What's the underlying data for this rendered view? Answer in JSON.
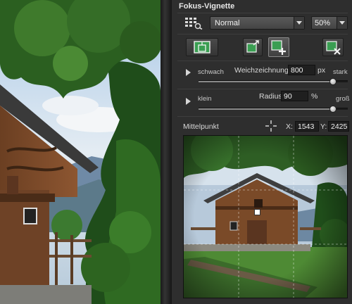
{
  "panel": {
    "title": "Fokus-Vignette",
    "blend_mode": "Normal",
    "opacity": "50%"
  },
  "weichzeichnung": {
    "min_label": "schwach",
    "name": "Weichzeichnung",
    "value": "800",
    "unit": "px",
    "max_label": "stark",
    "slider_fraction": 0.9
  },
  "radius": {
    "min_label": "klein",
    "name": "Radius",
    "value": "90",
    "unit": "%",
    "max_label": "groß",
    "slider_fraction": 0.9
  },
  "mittelpunkt": {
    "label": "Mittelpunkt",
    "x_label": "X:",
    "x_value": "1543",
    "y_label": "Y:",
    "y_value": "2425"
  },
  "icons": {
    "preset_grid": "grid-select-icon",
    "mask_show": "show-mask-icon",
    "export": "export-icon",
    "add": "add-layer-icon",
    "delete": "delete-layer-icon",
    "crosshair": "crosshair-icon"
  },
  "colors": {
    "panel_bg": "#2e2e2e",
    "accent_green": "#3a9e52"
  }
}
